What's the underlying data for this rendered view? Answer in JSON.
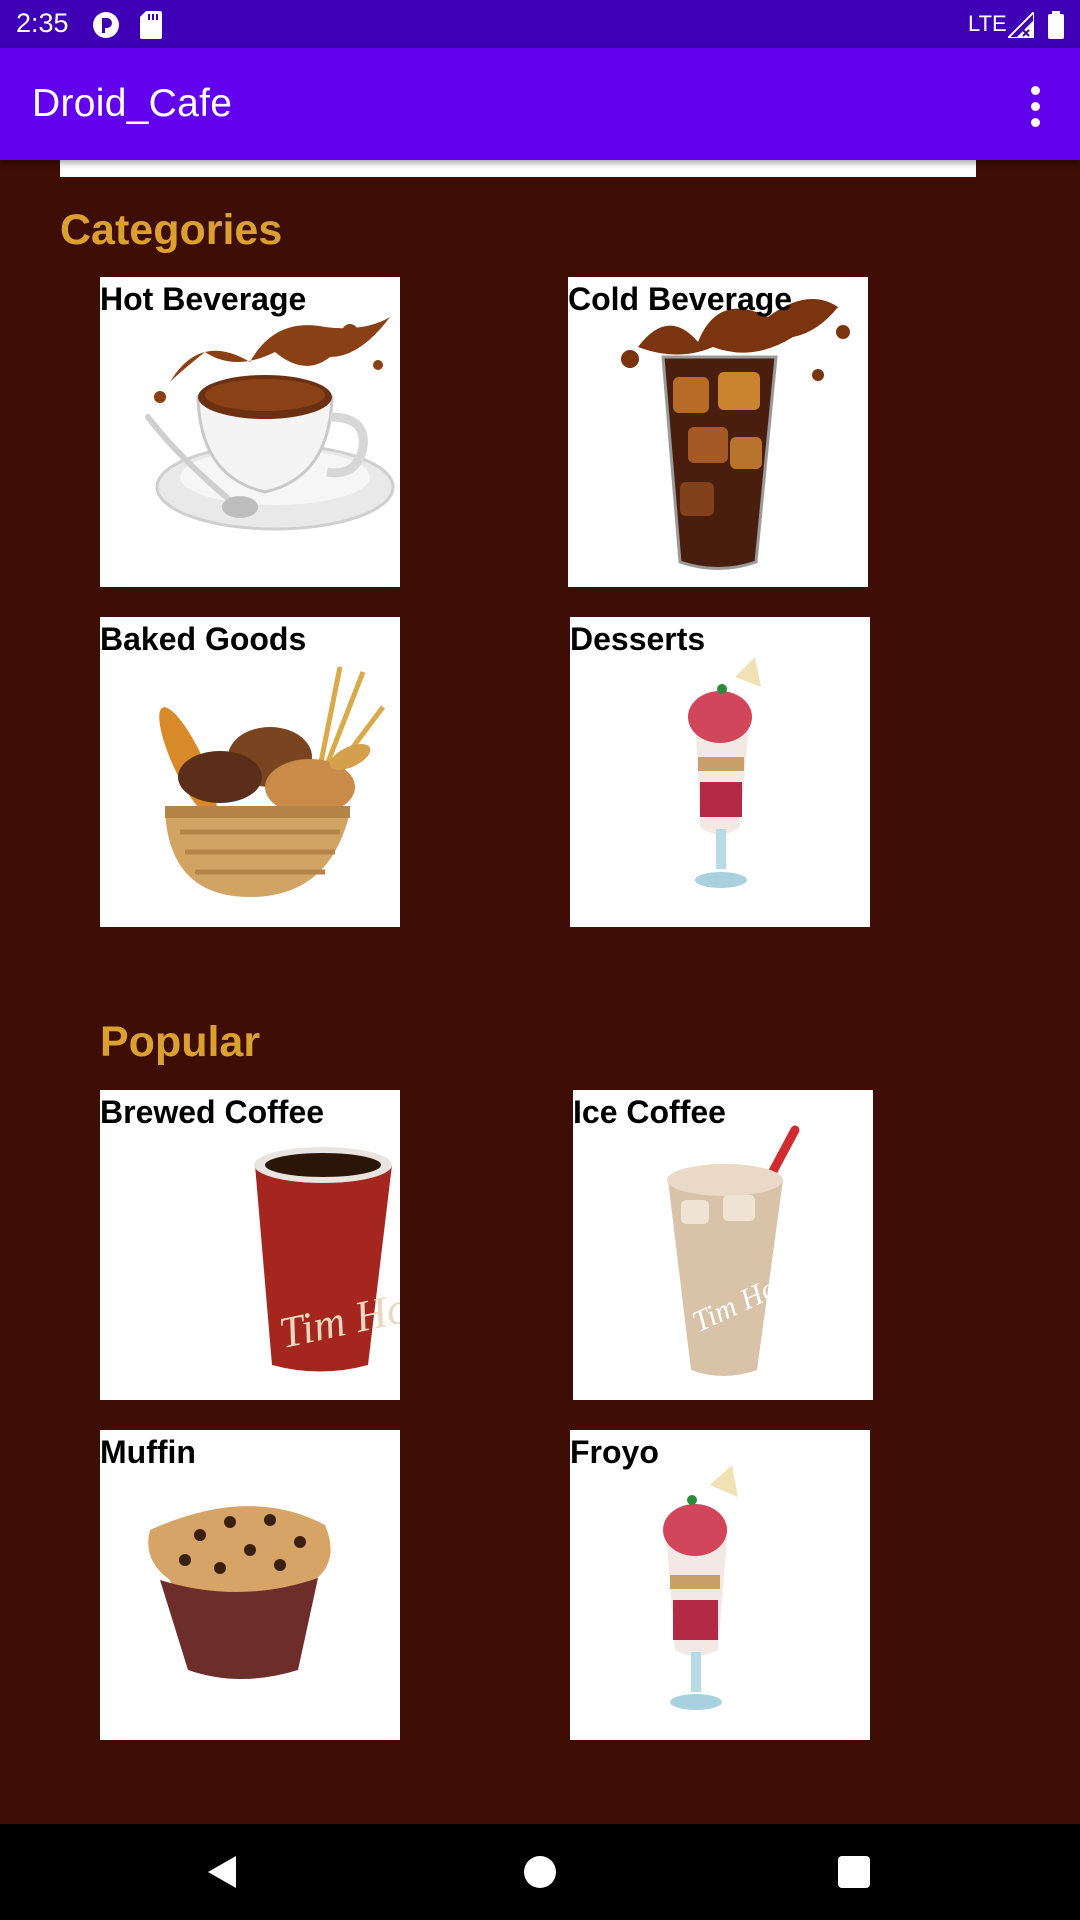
{
  "status_bar": {
    "time": "2:35",
    "network": "LTE",
    "icons": [
      "notification-icon",
      "sd-card-icon",
      "signal-icon",
      "battery-icon"
    ]
  },
  "app_bar": {
    "title": "Droid_Cafe",
    "menu_icon": "overflow-menu-icon"
  },
  "categories": {
    "title": "Categories",
    "items": [
      {
        "label": "Hot Beverage",
        "icon": "hot-beverage-cup-icon"
      },
      {
        "label": "Cold Beverage",
        "icon": "cold-beverage-glass-icon"
      },
      {
        "label": "Baked Goods",
        "icon": "bread-basket-icon"
      },
      {
        "label": "Desserts",
        "icon": "parfait-icon"
      }
    ]
  },
  "popular": {
    "title": "Popular",
    "items": [
      {
        "label": "Brewed Coffee",
        "icon": "coffee-cup-icon"
      },
      {
        "label": "Ice Coffee",
        "icon": "iced-coffee-icon"
      },
      {
        "label": "Muffin",
        "icon": "muffin-icon"
      },
      {
        "label": "Froyo",
        "icon": "froyo-parfait-icon"
      }
    ]
  },
  "nav_bar": {
    "icons": [
      "back-icon",
      "home-icon",
      "recents-icon"
    ]
  },
  "colors": {
    "status_bar": "#3f00b5",
    "app_bar": "#6200ee",
    "background": "#3d0d06",
    "section_title": "#daa131"
  }
}
